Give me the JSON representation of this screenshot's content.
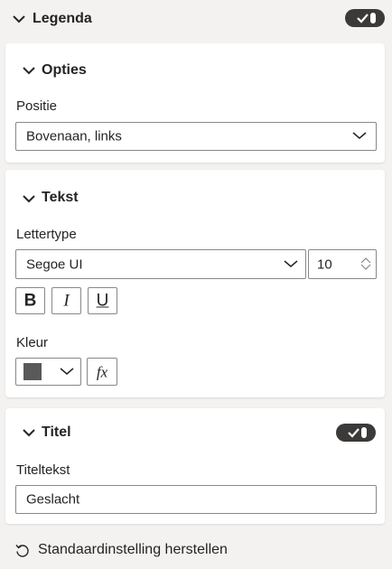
{
  "legend": {
    "title": "Legenda",
    "toggle_on": true
  },
  "options": {
    "title": "Opties",
    "position_label": "Positie",
    "position_value": "Bovenaan, links"
  },
  "text": {
    "title": "Tekst",
    "font_label": "Lettertype",
    "font_value": "Segoe UI",
    "size_value": "10",
    "bold_label": "B",
    "italic_label": "I",
    "underline_label": "U",
    "color_label": "Kleur",
    "color_value": "#595959",
    "fx_label": "fx"
  },
  "title_section": {
    "title": "Titel",
    "toggle_on": true,
    "text_label": "Titeltekst",
    "text_value": "Geslacht"
  },
  "reset_label": "Standaardinstelling herstellen",
  "colors": {
    "toggle": "#3b3a39",
    "card": "#ffffff",
    "panel": "#f3f2f1",
    "border": "#8a8886"
  },
  "icons": [
    "chevron-down-icon",
    "toggle-check-icon",
    "dropdown-arrow-icon",
    "spin-up-icon",
    "spin-down-icon",
    "reset-icon"
  ]
}
